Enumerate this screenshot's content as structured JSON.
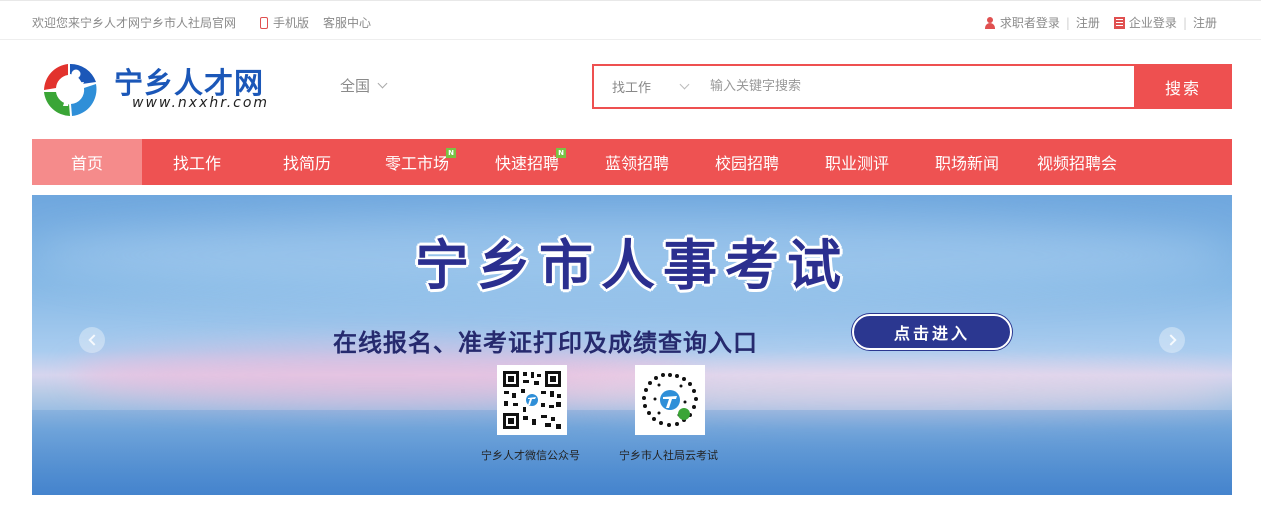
{
  "topbar": {
    "welcome": "欢迎您来宁乡人才网宁乡市人社局官网",
    "mobile": "手机版",
    "service": "客服中心",
    "jobseeker_login": "求职者登录",
    "jobseeker_register": "注册",
    "company_login": "企业登录",
    "company_register": "注册",
    "separator": "|"
  },
  "logo": {
    "title": "宁乡人才网",
    "url": "www.nxxhr.com"
  },
  "region": "全国",
  "search": {
    "scope": "找工作",
    "placeholder": "输入关键字搜索",
    "button": "搜索"
  },
  "nav": [
    {
      "label": "首页",
      "active": true
    },
    {
      "label": "找工作"
    },
    {
      "label": "找简历"
    },
    {
      "label": "零工市场",
      "badge": "N"
    },
    {
      "label": "快速招聘",
      "badge": "N"
    },
    {
      "label": "蓝领招聘"
    },
    {
      "label": "校园招聘"
    },
    {
      "label": "职业测评"
    },
    {
      "label": "职场新闻"
    },
    {
      "label": "视频招聘会"
    }
  ],
  "banner": {
    "title": "宁乡市人事考试",
    "subtitle": "在线报名、准考证打印及成绩查询入口",
    "cta": "点击进入",
    "qr1_label": "宁乡人才微信公众号",
    "qr2_label": "宁乡市人社局云考试"
  },
  "colors": {
    "accent": "#ee5252",
    "nav_active": "#f58b8b",
    "brand_blue": "#1b57b8",
    "badge_green": "#7bc143",
    "banner_title": "#2b2f8f"
  }
}
